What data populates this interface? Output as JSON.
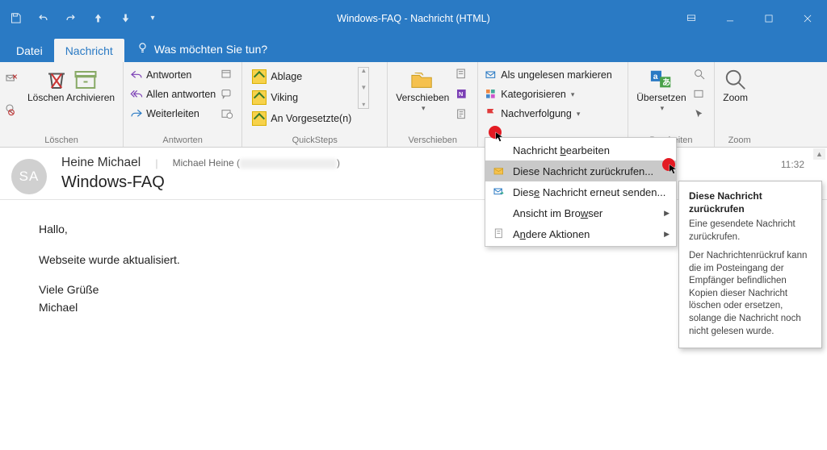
{
  "title_bar": "Windows-FAQ  -  Nachricht (HTML)",
  "tabs": {
    "file": "Datei",
    "message": "Nachricht"
  },
  "tellme_placeholder": "Was möchten Sie tun?",
  "ribbon": {
    "delete": {
      "archive_label": "Löschen Archivieren",
      "group": "Löschen"
    },
    "respond": {
      "reply": "Antworten",
      "reply_all": "Allen antworten",
      "forward": "Weiterleiten",
      "group": "Antworten"
    },
    "quicksteps": {
      "items": [
        "Ablage",
        "Viking",
        "An Vorgesetzte(n)"
      ],
      "group": "QuickSteps"
    },
    "move": {
      "label": "Verschieben",
      "group": "Verschieben"
    },
    "tags": {
      "unread": "Als ungelesen markieren",
      "categorize": "Kategorisieren",
      "followup": "Nachverfolgung"
    },
    "edit": {
      "translate": "Übersetzen",
      "group": "Bearbeiten"
    },
    "zoom": {
      "label": "Zoom",
      "group": "Zoom"
    }
  },
  "message": {
    "avatar_initials": "SA",
    "sender": "Heine Michael",
    "recipient_prefix": "Michael Heine (",
    "recipient_suffix": ")",
    "subject": "Windows-FAQ",
    "time": "11:32",
    "body": {
      "l1": "Hallo,",
      "l2": "Webseite wurde aktualisiert.",
      "l3": "Viele Grüße",
      "l4": "Michael"
    }
  },
  "dropdown": {
    "edit_msg": "Nachricht bearbeiten",
    "recall": "Diese Nachricht zurückrufen...",
    "resend": "Diese Nachricht erneut senden...",
    "browser": "Ansicht im Browser",
    "more": "Andere Aktionen"
  },
  "tooltip": {
    "title": "Diese Nachricht zurückrufen",
    "p1": "Eine gesendete Nachricht zurückrufen.",
    "p2": "Der Nachrichtenrückruf kann die im Posteingang der Empfänger befindlichen Kopien dieser Nachricht löschen oder ersetzen, solange die Nachricht noch nicht gelesen wurde."
  }
}
